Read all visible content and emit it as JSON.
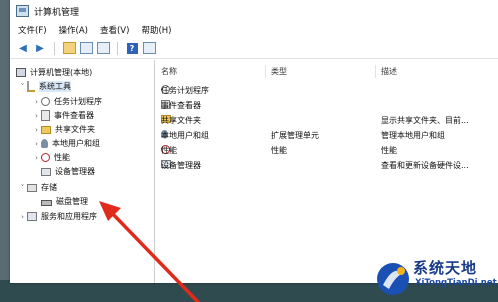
{
  "window": {
    "title": "计算机管理"
  },
  "menu": [
    "文件(F)",
    "操作(A)",
    "查看(V)",
    "帮助(H)"
  ],
  "tree": {
    "root": "计算机管理(本地)",
    "system_tools": "系统工具",
    "system_children": [
      "任务计划程序",
      "事件查看器",
      "共享文件夹",
      "本地用户和组",
      "性能",
      "设备管理器"
    ],
    "storage": "存储",
    "disk": "磁盘管理",
    "services": "服务和应用程序"
  },
  "list": {
    "headers": [
      "名称",
      "类型",
      "描述"
    ],
    "rows": [
      {
        "name": "任务计划程序",
        "type": "",
        "desc": ""
      },
      {
        "name": "事件查看器",
        "type": "",
        "desc": ""
      },
      {
        "name": "共享文件夹",
        "type": "",
        "desc": "显示共享文件夹、目前..."
      },
      {
        "name": "本地用户和组",
        "type": "扩展管理单元",
        "desc": "管理本地用户和组"
      },
      {
        "name": "性能",
        "type": "性能",
        "desc": "性能"
      },
      {
        "name": "设备管理器",
        "type": "",
        "desc": "查看和更新设备硬件设..."
      }
    ]
  },
  "watermark": {
    "title": "系统天地",
    "sub": "XiTongTianDi.net"
  }
}
